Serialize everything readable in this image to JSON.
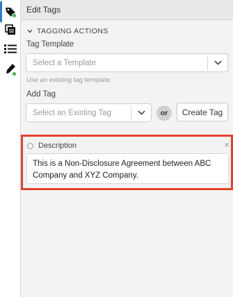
{
  "header": {
    "title": "Edit Tags"
  },
  "section": {
    "title": "TAGGING ACTIONS"
  },
  "tag_template": {
    "label": "Tag Template",
    "placeholder": "Select a Template",
    "hint": "Use an existing tag template."
  },
  "add_tag": {
    "label": "Add Tag",
    "placeholder": "Select an Existing Tag",
    "or_label": "or",
    "create_label": "Create Tag"
  },
  "tag": {
    "name": "Description",
    "value": "This is a Non-Disclosure Agreement between ABC Company and XYZ Company.",
    "close_glyph": "×"
  },
  "colors": {
    "accent": "#2a7ad6",
    "status_dot": "#3cb54a",
    "highlight_border": "#e5412d"
  }
}
